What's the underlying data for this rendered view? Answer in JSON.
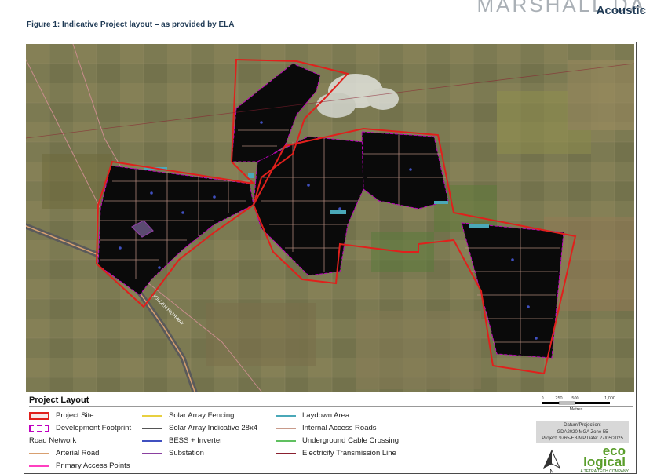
{
  "header": {
    "brand_top": "MARSHALL DA",
    "brand_sub": "Acoustic",
    "caption": "Figure 1: Indicative Project layout – as provided by ELA"
  },
  "map": {
    "road_label": "GOLDEN HIGHWAY",
    "colors": {
      "site_boundary": "#e0201c",
      "footprint": "#c000c0",
      "array": "#0a0a0a",
      "internal_road": "#c89a8a",
      "arterial_road": "#d8a070",
      "laydown": "#4aa8b8",
      "bess": "#4050c0",
      "substation": "#8a40a0",
      "terrain": "#7e7a55"
    }
  },
  "legend": {
    "title": "Project Layout",
    "col1": [
      {
        "icon": "project-site-swatch",
        "label": "Project Site"
      },
      {
        "icon": "development-footprint-swatch",
        "label": "Development Footprint"
      },
      {
        "icon": "",
        "label": "Road Network"
      },
      {
        "icon": "arterial-road-line",
        "label": "Arterial Road"
      },
      {
        "icon": "primary-access-line",
        "label": "Primary Access Points"
      }
    ],
    "col2": [
      {
        "icon": "solar-array-fencing-line",
        "label": "Solar Array Fencing"
      },
      {
        "icon": "solar-array-line",
        "label": "Solar Array Indicative 28x4"
      },
      {
        "icon": "bess-line",
        "label": "BESS + Inverter"
      },
      {
        "icon": "substation-line",
        "label": "Substation"
      }
    ],
    "col3": [
      {
        "icon": "laydown-area-line",
        "label": "Laydown Area"
      },
      {
        "icon": "internal-roads-line",
        "label": "Internal Access Roads"
      },
      {
        "icon": "cable-crossing-line",
        "label": "Underground Cable Crossing"
      },
      {
        "icon": "transmission-line",
        "label": "Electricity Transmission Line"
      }
    ],
    "scale": {
      "ticks": [
        "0",
        "250",
        "500",
        "1,000"
      ],
      "unit": "Metres"
    },
    "datum": {
      "line1": "Datum/Projection:",
      "line2": "GDA2020 MGA Zone 55",
      "line3": "Project: 9765-EB/MP Date: 27/05/2025"
    },
    "north_label": "N",
    "logo": {
      "line1": "eco",
      "line2": "logical",
      "line3": "A TETRA TECH COMPANY"
    }
  }
}
